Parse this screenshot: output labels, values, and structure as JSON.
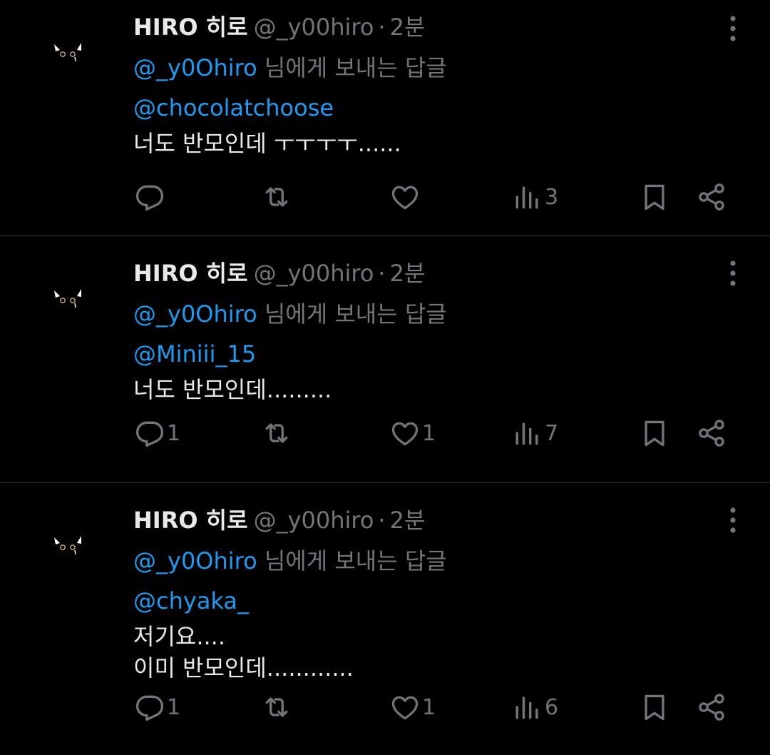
{
  "tweets": [
    {
      "author_name": "HIRO 히로",
      "handle": "@_y00hiro",
      "time": "2분",
      "reply_to_handle": "@_y0Ohiro",
      "reply_suffix": " 님에게 보내는 답글",
      "mention": "@chocolatchoose",
      "text": "너도 반모인데 ㅜㅜㅜㅜ......",
      "reply_count": "",
      "like_count": "",
      "view_count": "3"
    },
    {
      "author_name": "HIRO 히로",
      "handle": "@_y00hiro",
      "time": "2분",
      "reply_to_handle": "@_y0Ohiro",
      "reply_suffix": " 님에게 보내는 답글",
      "mention": "@Miniii_15",
      "text": "너도 반모인데.........",
      "reply_count": "1",
      "like_count": "1",
      "view_count": "7"
    },
    {
      "author_name": "HIRO 히로",
      "handle": "@_y00hiro",
      "time": "2분",
      "reply_to_handle": "@_y0Ohiro",
      "reply_suffix": " 님에게 보내는 답글",
      "mention": "@chyaka_",
      "text": "저기요....\n이미 반모인데............",
      "reply_count": "1",
      "like_count": "1",
      "view_count": "6"
    }
  ],
  "separator_dot": "·",
  "icons": {
    "reply": "reply-icon",
    "retweet": "retweet-icon",
    "like": "heart-icon",
    "views": "views-icon",
    "bookmark": "bookmark-icon",
    "share": "share-icon",
    "more": "more-vertical-icon"
  },
  "colors": {
    "background": "#000000",
    "text": "#e7e9ea",
    "muted": "#71767b",
    "link": "#1d9bf0",
    "separator": "#2f3336"
  }
}
